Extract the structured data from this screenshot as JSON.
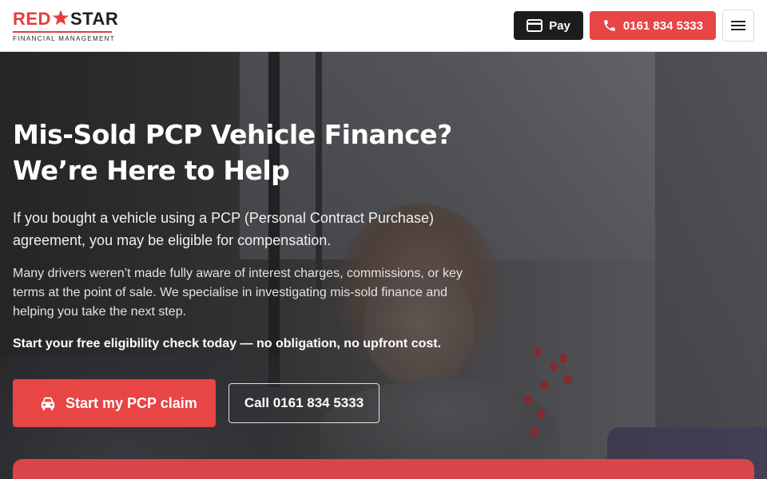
{
  "brand": {
    "name_red": "RED",
    "name_dark": "STAR",
    "tagline": "FINANCIAL MANAGEMENT",
    "accent_color": "#e84545",
    "dark_color": "#1c1c1c"
  },
  "header": {
    "pay_label": "Pay",
    "pay_icon": "credit-card-icon",
    "phone_label": "0161 834 5333",
    "phone_icon": "phone-icon",
    "menu_icon": "hamburger-menu-icon"
  },
  "hero": {
    "title_line1": "Mis-Sold PCP Vehicle Finance?",
    "title_line2": "We’re Here to Help",
    "lead": "If you bought a vehicle using a PCP (Personal Contract Purchase) agreement, you may be eligible for compensation.",
    "body": "Many drivers weren’t made fully aware of interest charges, commissions, or key terms at the point of sale. We specialise in investigating mis-sold finance and helping you take the next step.",
    "cta_text": "Start your free eligibility check today — no obligation, no upfront cost.",
    "primary_button": "Start my PCP claim",
    "primary_icon": "car-icon",
    "secondary_button": "Call 0161 834 5333"
  }
}
